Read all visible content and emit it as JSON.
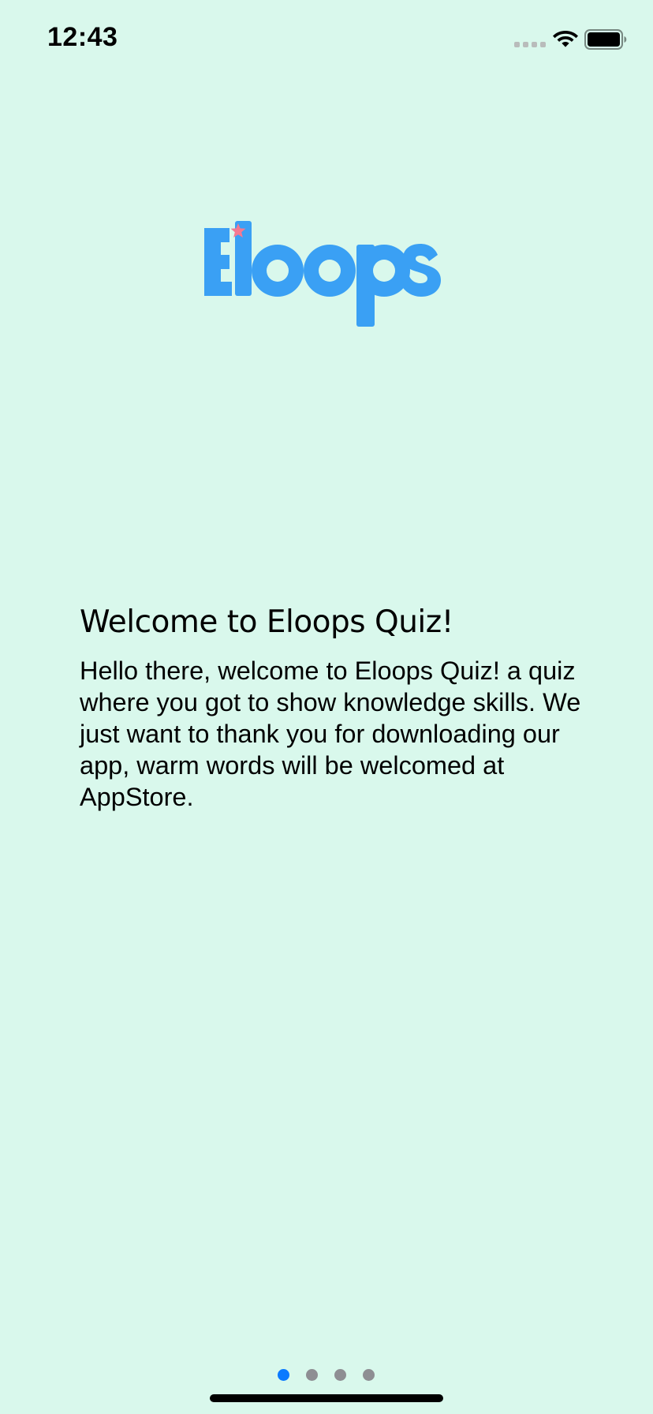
{
  "status_bar": {
    "time": "12:43"
  },
  "logo": {
    "text": "Eloops",
    "color": "#3aa0f4",
    "star_color": "#f47991"
  },
  "welcome": {
    "title": "Welcome to Eloops Quiz!",
    "body": "Hello there, welcome to Eloops Quiz! a quiz where you got to show knowledge skills. We just want to thank you for downloading our app, warm words will be welcomed at AppStore."
  },
  "pagination": {
    "total_pages": 4,
    "current_page": 1,
    "active_color": "#0a7aff",
    "inactive_color": "#8e8e93"
  },
  "colors": {
    "background": "#d9f8ec"
  }
}
